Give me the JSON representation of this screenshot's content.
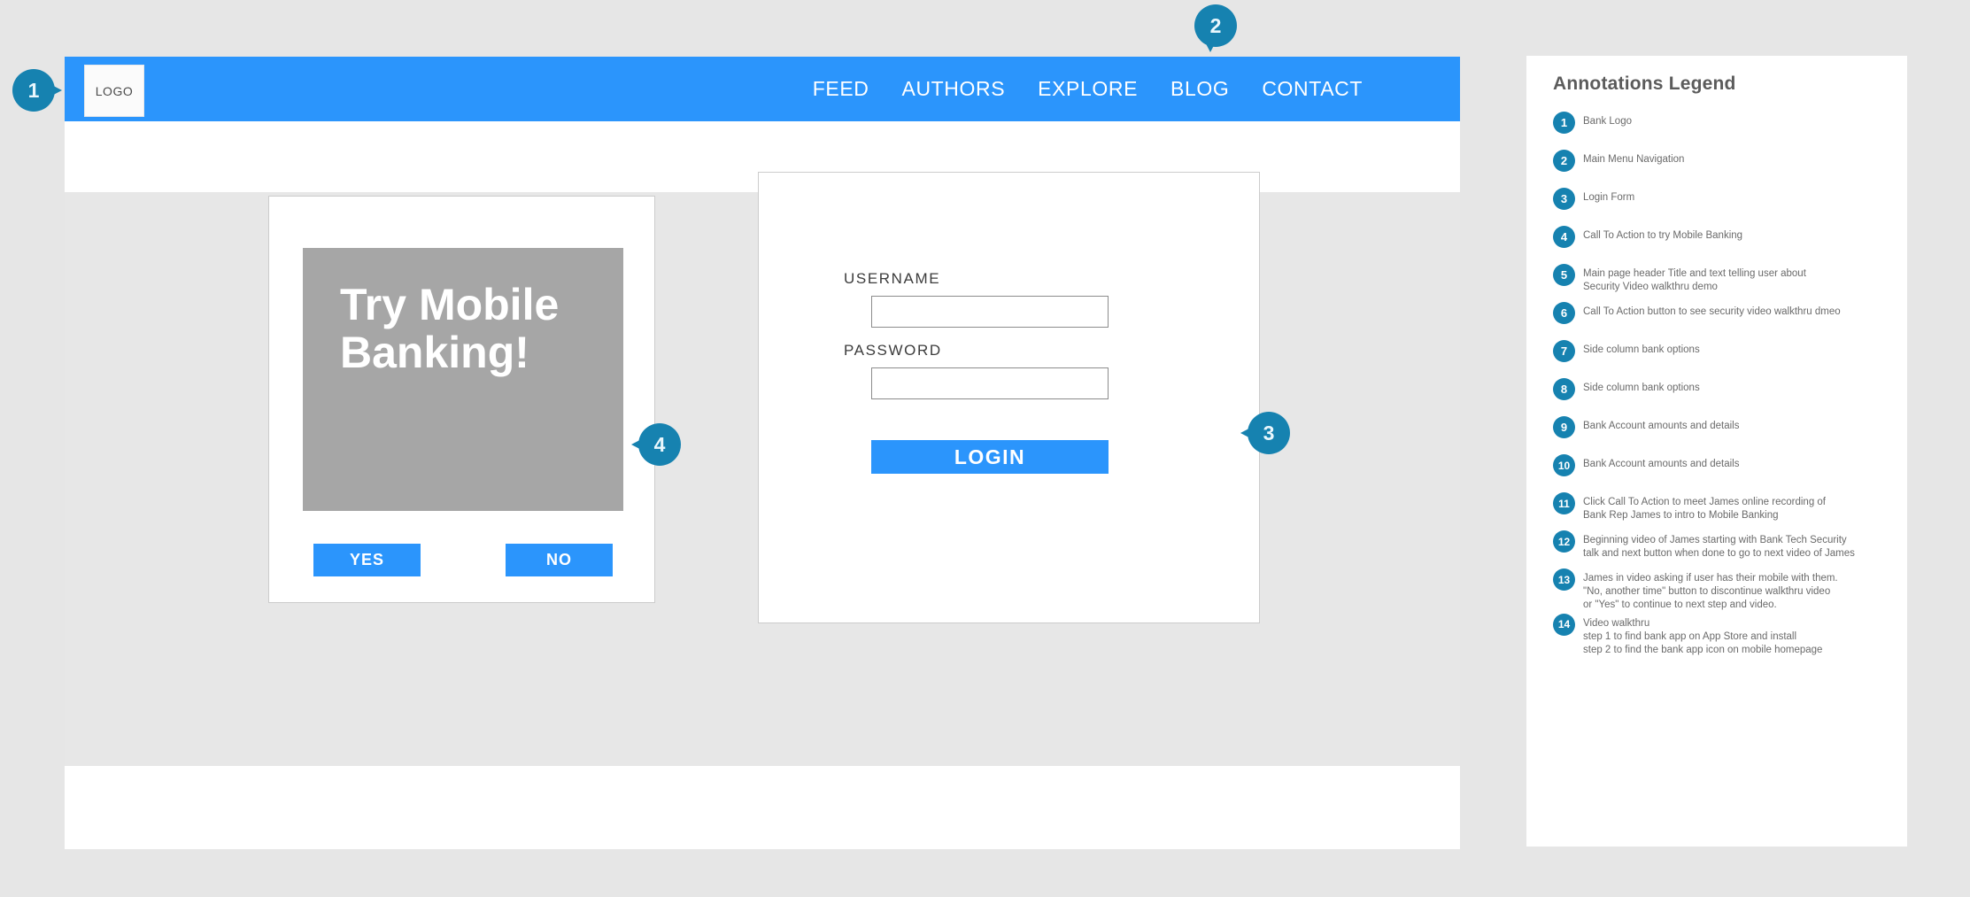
{
  "colors": {
    "page_background": "#e6e6e6",
    "nav_blue": "#2b95fc",
    "marker_teal": "#1682b0",
    "promo_image_grey": "#a6a6a6",
    "content_grey": "#e7e7e7"
  },
  "wireframe": {
    "navbar": {
      "logo_label": "LOGO",
      "links": [
        {
          "label": "FEED"
        },
        {
          "label": "AUTHORS"
        },
        {
          "label": "EXPLORE"
        },
        {
          "label": "BLOG"
        },
        {
          "label": "CONTACT"
        }
      ]
    },
    "promo_card": {
      "headline": "Try Mobile Banking!",
      "yes_label": "YES",
      "no_label": "NO"
    },
    "login_card": {
      "username_label": "USERNAME",
      "username_value": "",
      "username_placeholder": "",
      "password_label": "PASSWORD",
      "password_value": "",
      "password_placeholder": "",
      "login_label": "LOGIN"
    }
  },
  "markers": [
    {
      "number": "1",
      "direction": "point-right"
    },
    {
      "number": "2",
      "direction": "point-down"
    },
    {
      "number": "3",
      "direction": "point-left"
    },
    {
      "number": "4",
      "direction": "point-left"
    }
  ],
  "legend": {
    "title": "Annotations Legend",
    "items": [
      {
        "number": "1",
        "text": "Bank Logo"
      },
      {
        "number": "2",
        "text": "Main Menu Navigation"
      },
      {
        "number": "3",
        "text": "Login Form"
      },
      {
        "number": "4",
        "text": "Call To Action to try Mobile Banking"
      },
      {
        "number": "5",
        "text": "Main page header Title and text telling user about\nSecurity Video walkthru demo"
      },
      {
        "number": "6",
        "text": "Call To Action button to see security video walkthru dmeo"
      },
      {
        "number": "7",
        "text": "Side column bank options"
      },
      {
        "number": "8",
        "text": "Side column bank options"
      },
      {
        "number": "9",
        "text": "Bank Account amounts and details"
      },
      {
        "number": "10",
        "text": "Bank Account amounts and details"
      },
      {
        "number": "11",
        "text": "Click Call To Action to meet James online recording of\nBank Rep James to intro to Mobile Banking"
      },
      {
        "number": "12",
        "text": "Beginning video of James starting with Bank Tech Security\ntalk and next button when done to go to next video of James"
      },
      {
        "number": "13",
        "text": "James in video asking if user has their mobile with them.\n\"No, another time\" button to discontinue walkthru video\nor \"Yes\" to continue to next step and video."
      },
      {
        "number": "14",
        "text": "Video walkthru\nstep 1 to find bank app on App Store and install\nstep 2 to find the bank app icon on mobile homepage"
      }
    ]
  }
}
